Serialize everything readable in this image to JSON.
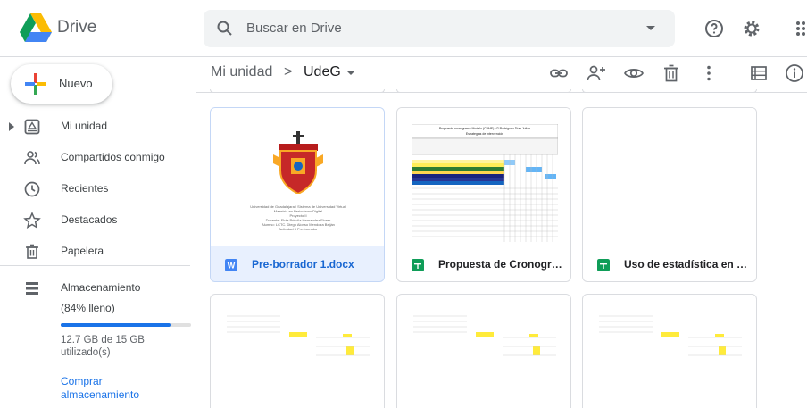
{
  "header": {
    "brand": "Drive",
    "search_placeholder": "Buscar en Drive"
  },
  "sidebar": {
    "new_label": "Nuevo",
    "items": [
      {
        "label": "Mi unidad",
        "icon": "my-drive-icon"
      },
      {
        "label": "Compartidos conmigo",
        "icon": "shared-people-icon"
      },
      {
        "label": "Recientes",
        "icon": "clock-icon"
      },
      {
        "label": "Destacados",
        "icon": "star-icon"
      },
      {
        "label": "Papelera",
        "icon": "trash-icon"
      }
    ],
    "storage": {
      "label": "Almacenamiento",
      "percent_text": "(84% lleno)",
      "fill_fraction": 0.84,
      "usage_text": "12.7 GB de 15 GB utilizado(s)",
      "buy_text": "Comprar almacenamiento"
    }
  },
  "breadcrumb": {
    "root": "Mi unidad",
    "separator": ">",
    "current": "UdeG"
  },
  "files": [
    {
      "name": "Pre-borrador 1.docx",
      "type": "word",
      "selected": true
    },
    {
      "name": "Propuesta de Cronogram...",
      "type": "sheets",
      "selected": false
    },
    {
      "name": "Uso de estadística en sit...",
      "type": "sheets",
      "selected": false
    }
  ],
  "doc_preview": {
    "lines": [
      "Universidad de Guadalajara / Sistema de Universidad Virtual",
      "Maestría en Periodismo Digital",
      "Proyecto II",
      "Docente: Elvia Priscila Hernandez Flores",
      "Alumno: LCTC. Diego Alonso Mendoza Beiján",
      "Actividad 3 Pre-borrador"
    ]
  },
  "sheet_preview": {
    "title": "Propuesta cronograma Modelo (CBME) V2 Rodríguez Díaz Julián",
    "subtitle": "Estrategias de intervención"
  },
  "colors": {
    "accent": "#1a73e8",
    "word": "#4285f4",
    "sheets": "#0f9d58"
  }
}
